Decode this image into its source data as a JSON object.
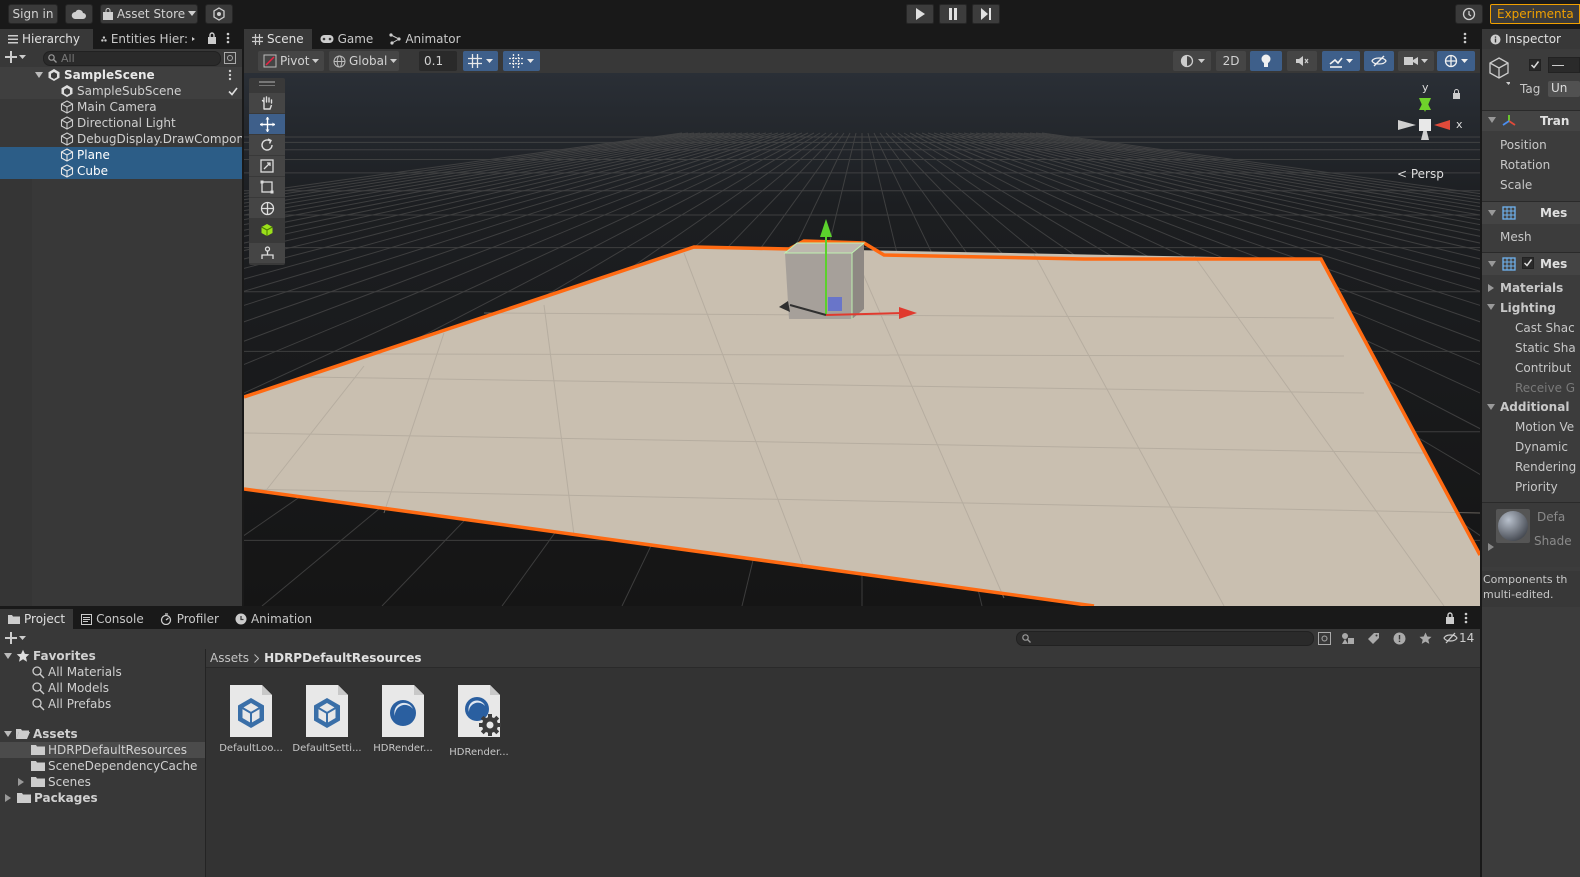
{
  "toolbar": {
    "sign_in": "Sign in",
    "asset_store": "Asset Store",
    "experimental": "Experimenta"
  },
  "hierarchy": {
    "tabs": [
      "Hierarchy",
      "Entities Hier:"
    ],
    "search_placeholder": "All",
    "scene": "SampleScene",
    "items": [
      {
        "label": "SampleSubScene",
        "selected": false,
        "icon": "subscene-icon"
      },
      {
        "label": "Main Camera",
        "selected": false,
        "icon": "gameobject-icon"
      },
      {
        "label": "Directional Light",
        "selected": false,
        "icon": "gameobject-icon"
      },
      {
        "label": "DebugDisplay.DrawCompone",
        "selected": false,
        "icon": "gameobject-icon"
      },
      {
        "label": "Plane",
        "selected": true,
        "icon": "gameobject-icon"
      },
      {
        "label": "Cube",
        "selected": true,
        "icon": "gameobject-icon"
      }
    ]
  },
  "scene_view": {
    "tabs": [
      "Scene",
      "Game",
      "Animator"
    ],
    "pivot": "Pivot",
    "global": "Global",
    "snap_value": "0.1",
    "mode_2d": "2D",
    "gizmo": {
      "y": "y",
      "x": "x",
      "projection": "< Persp"
    }
  },
  "inspector": {
    "title": "Inspector",
    "tag_label": "Tag",
    "tag_value": "Un",
    "transform_header": "Tran",
    "transform_fields": [
      "Position",
      "Rotation",
      "Scale"
    ],
    "mesh_filter_header": "Mes",
    "mesh_label": "Mesh",
    "mesh_renderer_header": "Mes",
    "materials": "Materials",
    "lighting": "Lighting",
    "lighting_fields": [
      "Cast Shac",
      "Static Sha",
      "Contribut",
      "Receive G"
    ],
    "additional": "Additional",
    "additional_fields": [
      "Motion Ve",
      "Dynamic",
      "Rendering",
      "Priority"
    ],
    "material_name": "Defa",
    "material_shader": "Shade",
    "note_line1": "Components th",
    "note_line2": "multi-edited."
  },
  "project": {
    "tabs": [
      "Project",
      "Console",
      "Profiler",
      "Animation"
    ],
    "hidden_count": "14",
    "favorites": "Favorites",
    "favorite_items": [
      "All Materials",
      "All Models",
      "All Prefabs"
    ],
    "assets": "Assets",
    "asset_folders": [
      "HDRPDefaultResources",
      "SceneDependencyCache",
      "Scenes"
    ],
    "packages": "Packages",
    "breadcrumb_root": "Assets",
    "breadcrumb_current": "HDRPDefaultResources",
    "files": [
      {
        "label": "DefaultLoo...",
        "icon": "prefab-icon"
      },
      {
        "label": "DefaultSetti...",
        "icon": "prefab-icon"
      },
      {
        "label": "HDRender...",
        "icon": "render-pipeline-asset-icon"
      },
      {
        "label": "HDRender...",
        "icon": "render-pipeline-settings-icon"
      }
    ]
  },
  "colors": {
    "selection": "#2c5d87",
    "active_tool": "#3e5f8a",
    "outline": "#ff6a12",
    "plane": "#c9bfb0",
    "accent": "#f0a000"
  }
}
